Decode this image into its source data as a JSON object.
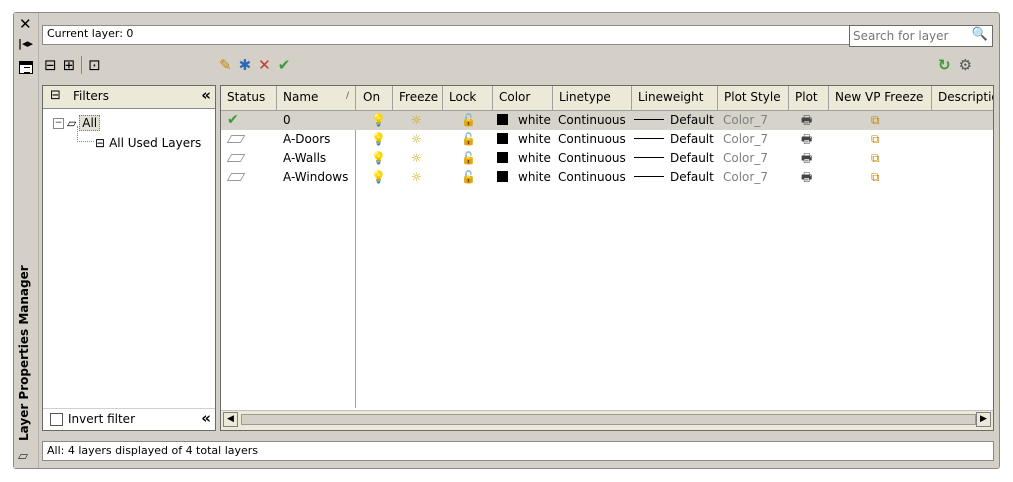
{
  "window": {
    "title": "Layer Properties Manager",
    "icons": {
      "close": "close-icon",
      "autohide": "autohide-icon",
      "properties": "properties-icon"
    }
  },
  "current_layer": "Current layer: 0",
  "search": {
    "placeholder": "Search for layer"
  },
  "toolbar": {
    "left": [
      "new-property-filter-icon",
      "new-group-filter-icon",
      "layer-states-manager-icon"
    ],
    "mid": [
      "new-layer-icon",
      "new-layer-vp-frozen-icon",
      "delete-layer-icon",
      "set-current-icon"
    ],
    "right": [
      "refresh-icon",
      "settings-icon"
    ]
  },
  "filters": {
    "header": "Filters",
    "tree": {
      "all": "All",
      "used": "All Used Layers"
    },
    "invert_label": "Invert filter"
  },
  "columns": [
    "Status",
    "Name",
    "On",
    "Freeze",
    "Lock",
    "Color",
    "Linetype",
    "Lineweight",
    "Plot Style",
    "Plot",
    "New VP Freeze",
    "Descriptio"
  ],
  "layers": [
    {
      "status": "current",
      "name": "0",
      "color": "white",
      "linetype": "Continuous",
      "lineweight": "Default",
      "plot_style": "Color_7"
    },
    {
      "status": "",
      "name": "A-Doors",
      "color": "white",
      "linetype": "Continuous",
      "lineweight": "Default",
      "plot_style": "Color_7"
    },
    {
      "status": "",
      "name": "A-Walls",
      "color": "white",
      "linetype": "Continuous",
      "lineweight": "Default",
      "plot_style": "Color_7"
    },
    {
      "status": "",
      "name": "A-Windows",
      "color": "white",
      "linetype": "Continuous",
      "lineweight": "Default",
      "plot_style": "Color_7"
    }
  ],
  "status_bar": "All: 4 layers displayed of 4 total layers",
  "colors": {
    "panel": "#d4d0c8",
    "header": "#ece9d8",
    "selected_row": "#d6d3cb",
    "check_green": "#3a9a3a",
    "delete_red": "#c0392b"
  }
}
